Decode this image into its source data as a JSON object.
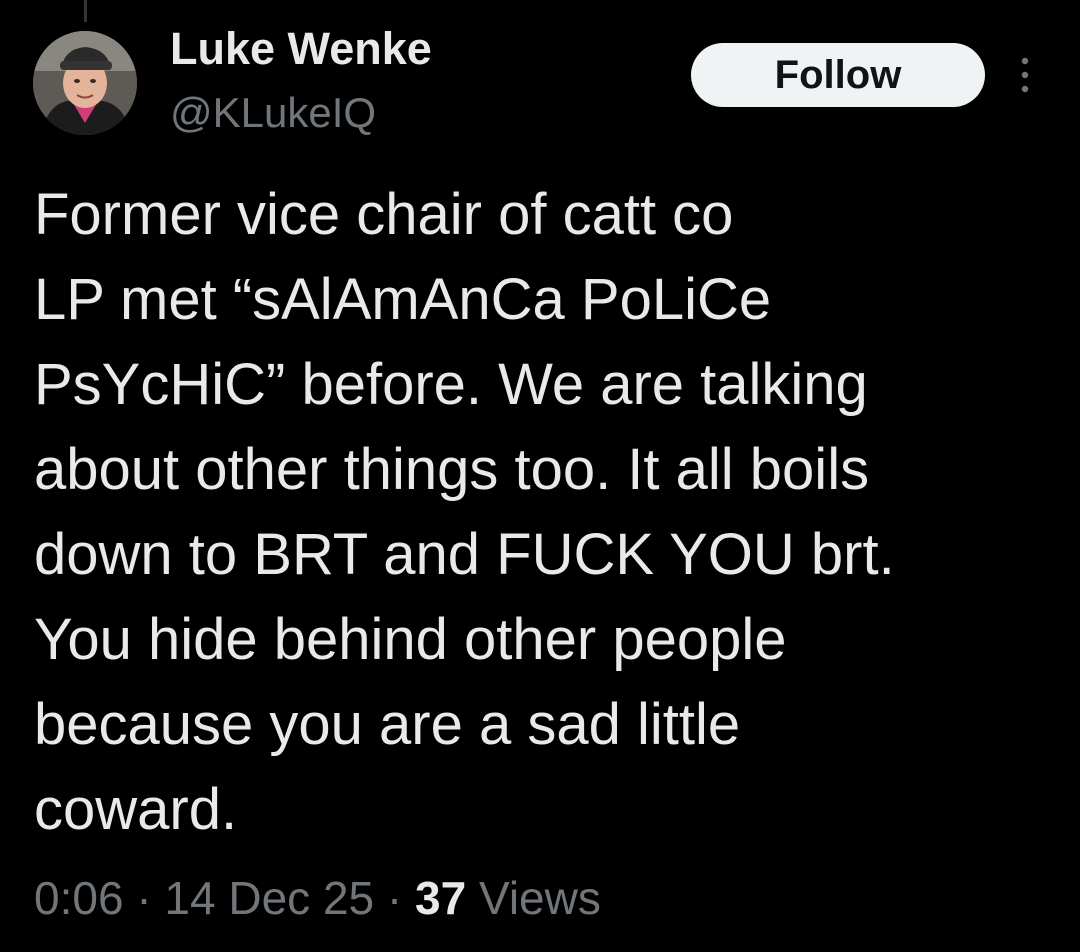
{
  "author": {
    "name": "Luke Wenke",
    "handle": "@KLukeIQ"
  },
  "actions": {
    "follow_label": "Follow",
    "more_icon": "more-dots-vertical-icon"
  },
  "tweet": {
    "lines": [
      "Former vice chair of catt co",
      "LP met “sAlAmAnCa PoLiCe",
      "PsYcHiC” before.  We are talking",
      "about other things too.  It all boils",
      "down to BRT and FUCK YOU brt.",
      "You hide behind other people",
      "because you are a sad little",
      "coward."
    ]
  },
  "meta": {
    "time": "0:06",
    "separator": "·",
    "date": "14 Dec 25",
    "views_count": "37",
    "views_label": "Views"
  },
  "colors": {
    "background": "#000000",
    "primary_text": "#e7e9ea",
    "secondary_text": "#71767b",
    "follow_button_bg": "#eff3f4",
    "follow_button_text": "#0f1419"
  }
}
